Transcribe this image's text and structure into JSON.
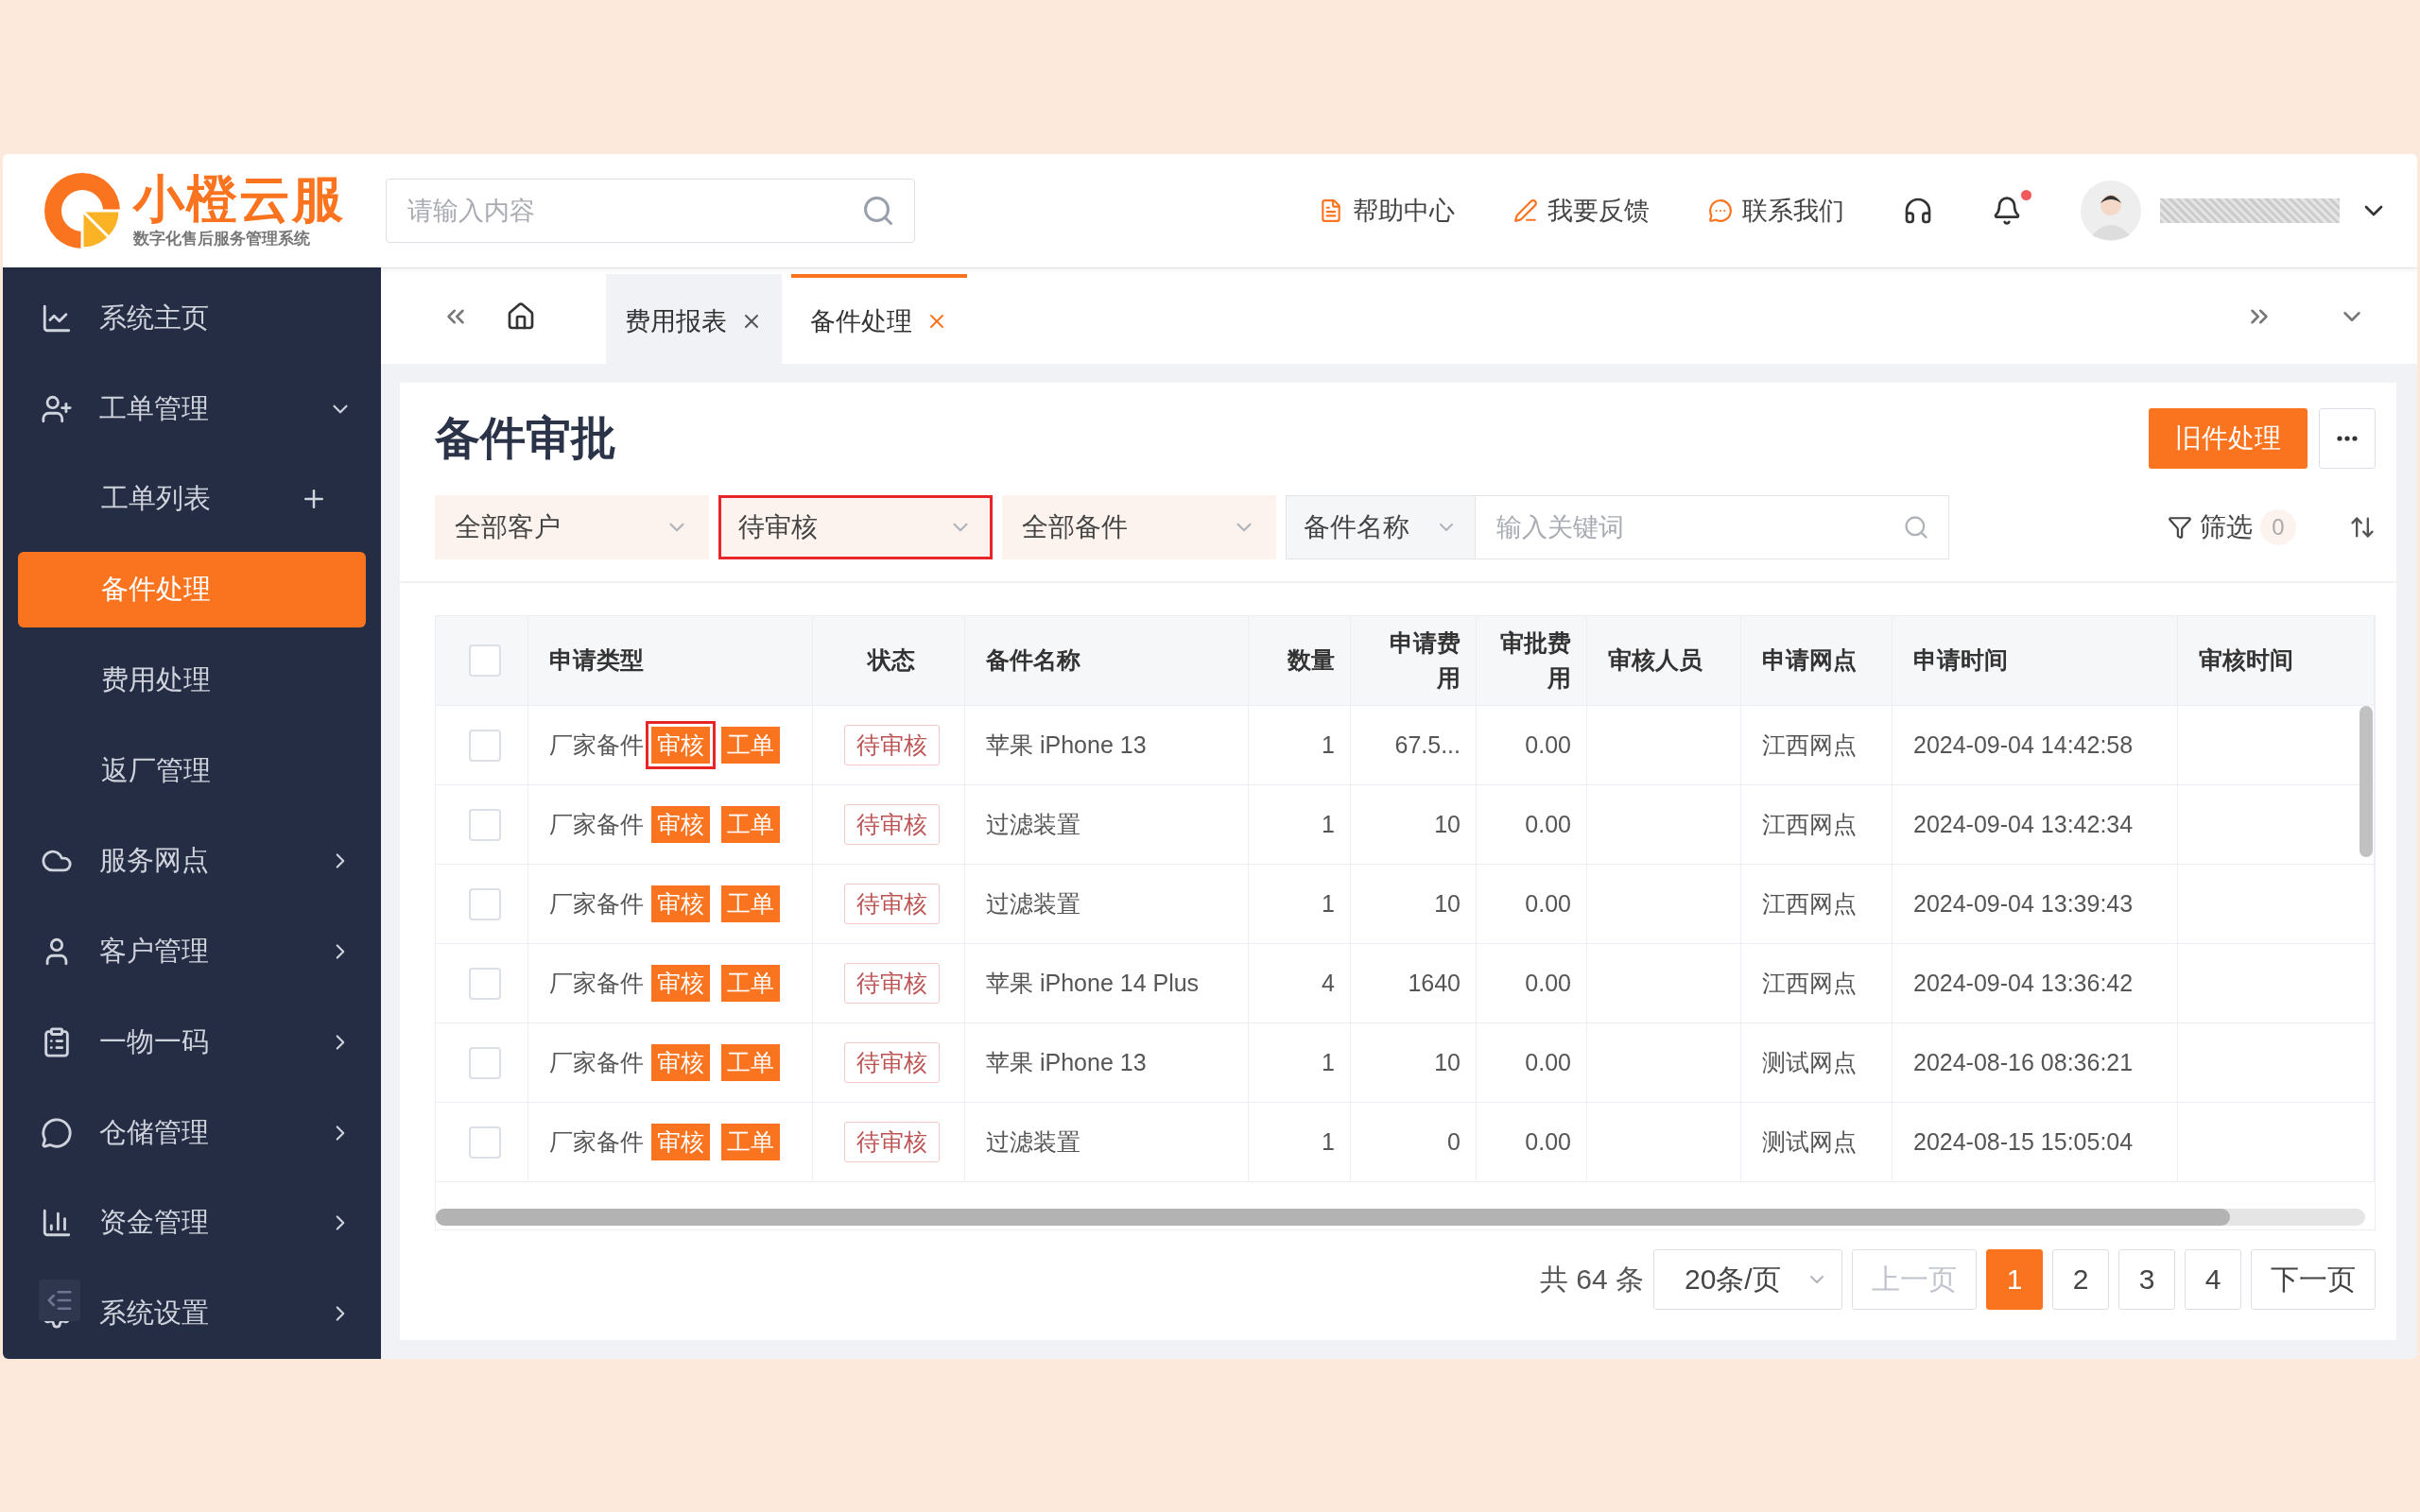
{
  "header": {
    "logo_title": "小橙云服",
    "logo_subtitle": "数字化售后服务管理系统",
    "search": {
      "placeholder": "请输入内容"
    },
    "links": [
      {
        "label": "帮助中心"
      },
      {
        "label": "我要反馈"
      },
      {
        "label": "联系我们"
      }
    ],
    "notification_dot": true
  },
  "sidebar": {
    "items": [
      {
        "label": "系统主页"
      },
      {
        "label": "工单管理",
        "expanded": true,
        "children": [
          {
            "label": "工单列表",
            "selected": false
          },
          {
            "label": "备件处理",
            "selected": true
          },
          {
            "label": "费用处理",
            "selected": false
          },
          {
            "label": "返厂管理",
            "selected": false
          }
        ]
      },
      {
        "label": "服务网点",
        "expanded": false
      },
      {
        "label": "客户管理",
        "expanded": false
      },
      {
        "label": "一物一码",
        "expanded": false
      },
      {
        "label": "仓储管理",
        "expanded": false
      },
      {
        "label": "资金管理",
        "expanded": false
      },
      {
        "label": "系统设置",
        "expanded": false
      }
    ]
  },
  "tabs": [
    {
      "label": "费用报表",
      "selected": false
    },
    {
      "label": "备件处理",
      "selected": true
    }
  ],
  "page": {
    "title": "备件审批",
    "primary_button": "旧件处理",
    "filters": [
      {
        "value": "全部客户",
        "highlighted": false
      },
      {
        "value": "待审核",
        "highlighted": true
      },
      {
        "value": "全部备件",
        "highlighted": false
      }
    ],
    "search": {
      "field": "备件名称",
      "placeholder": "输入关键词"
    },
    "filter_button": {
      "label": "筛选",
      "count": "0"
    }
  },
  "table": {
    "header_checked": false,
    "columns": [
      "申请类型",
      "状态",
      "备件名称",
      "数量",
      "申请费用",
      "审批费用",
      "审核人员",
      "申请网点",
      "申请时间",
      "审核时间"
    ],
    "rows": [
      {
        "checked": false,
        "type": "厂家备件",
        "tags": [
          {
            "label": "审核",
            "highlighted": true
          },
          {
            "label": "工单",
            "highlighted": false
          }
        ],
        "status": "待审核",
        "part": "苹果 iPhone 13",
        "qty": "1",
        "apply_fee": "67.5...",
        "approve_fee": "0.00",
        "outlet": "江西网点",
        "apply_time": "2024-09-04 14:42:58"
      },
      {
        "checked": false,
        "type": "厂家备件",
        "tags": [
          {
            "label": "审核",
            "highlighted": false
          },
          {
            "label": "工单",
            "highlighted": false
          }
        ],
        "status": "待审核",
        "part": "过滤装置",
        "qty": "1",
        "apply_fee": "10",
        "approve_fee": "0.00",
        "outlet": "江西网点",
        "apply_time": "2024-09-04 13:42:34"
      },
      {
        "checked": false,
        "type": "厂家备件",
        "tags": [
          {
            "label": "审核",
            "highlighted": false
          },
          {
            "label": "工单",
            "highlighted": false
          }
        ],
        "status": "待审核",
        "part": "过滤装置",
        "qty": "1",
        "apply_fee": "10",
        "approve_fee": "0.00",
        "outlet": "江西网点",
        "apply_time": "2024-09-04 13:39:43"
      },
      {
        "checked": false,
        "type": "厂家备件",
        "tags": [
          {
            "label": "审核",
            "highlighted": false
          },
          {
            "label": "工单",
            "highlighted": false
          }
        ],
        "status": "待审核",
        "part": "苹果 iPhone 14 Plus",
        "qty": "4",
        "apply_fee": "1640",
        "approve_fee": "0.00",
        "outlet": "江西网点",
        "apply_time": "2024-09-04 13:36:42"
      },
      {
        "checked": false,
        "type": "厂家备件",
        "tags": [
          {
            "label": "审核",
            "highlighted": false
          },
          {
            "label": "工单",
            "highlighted": false
          }
        ],
        "status": "待审核",
        "part": "苹果 iPhone 13",
        "qty": "1",
        "apply_fee": "10",
        "approve_fee": "0.00",
        "outlet": "测试网点",
        "apply_time": "2024-08-16 08:36:21"
      },
      {
        "checked": false,
        "type": "厂家备件",
        "tags": [
          {
            "label": "审核",
            "highlighted": false
          },
          {
            "label": "工单",
            "highlighted": false
          }
        ],
        "status": "待审核",
        "part": "过滤装置",
        "qty": "1",
        "apply_fee": "0",
        "approve_fee": "0.00",
        "outlet": "测试网点",
        "apply_time": "2024-08-15 15:05:04"
      }
    ]
  },
  "pagination": {
    "total": "共 64 条",
    "page_size": "20条/页",
    "prev": {
      "label": "上一页",
      "disabled": true
    },
    "pages": [
      {
        "label": "1",
        "selected": true
      },
      {
        "label": "2",
        "selected": false
      },
      {
        "label": "3",
        "selected": false
      },
      {
        "label": "4",
        "selected": false
      }
    ],
    "next": {
      "label": "下一页",
      "disabled": false
    }
  }
}
